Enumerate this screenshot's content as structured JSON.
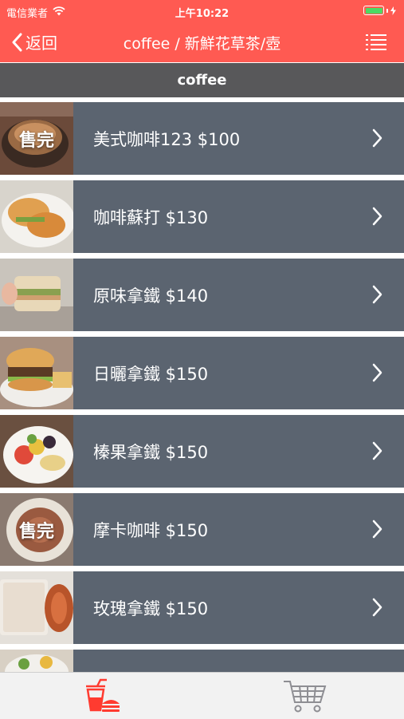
{
  "status_bar": {
    "carrier": "電信業者",
    "time": "上午10:22",
    "battery_color": "#4cd964"
  },
  "nav": {
    "back_label": "返回",
    "title": "coffee / 新鮮花草茶/壺",
    "accent_color": "#ff5a52",
    "menu_icon": "list-icon"
  },
  "section": {
    "title": "coffee"
  },
  "items": [
    {
      "label": "美式咖啡123 $100",
      "sold_out": "售完"
    },
    {
      "label": "咖啡蘇打 $130"
    },
    {
      "label": "原味拿鐵 $140"
    },
    {
      "label": "日曬拿鐵 $150"
    },
    {
      "label": "榛果拿鐵 $150"
    },
    {
      "label": "摩卡咖啡 $150",
      "sold_out": "售完"
    },
    {
      "label": "玫瑰拿鐵 $150"
    },
    {
      "label": ""
    }
  ],
  "tabbar": {
    "tabs": [
      {
        "icon": "drink-food-icon",
        "active": true
      },
      {
        "icon": "cart-icon",
        "active": false
      }
    ]
  }
}
